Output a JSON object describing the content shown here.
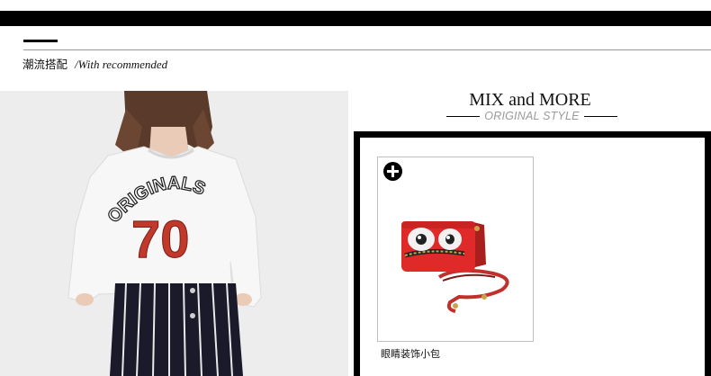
{
  "header": {
    "title_zh": "潮流搭配",
    "title_en": "/With recommended"
  },
  "feature": {
    "title": "MIX and MORE",
    "subtitle": "ORIGINAL STYLE"
  },
  "photo": {
    "print_text": "ORIGINALS",
    "print_number": "70"
  },
  "products": [
    {
      "name": "眼睛装饰小包",
      "icon": "plus-circle-icon"
    }
  ],
  "colors": {
    "accent": "#000000",
    "bag": "#e02a2a",
    "subtitle": "#9a9a9a"
  }
}
